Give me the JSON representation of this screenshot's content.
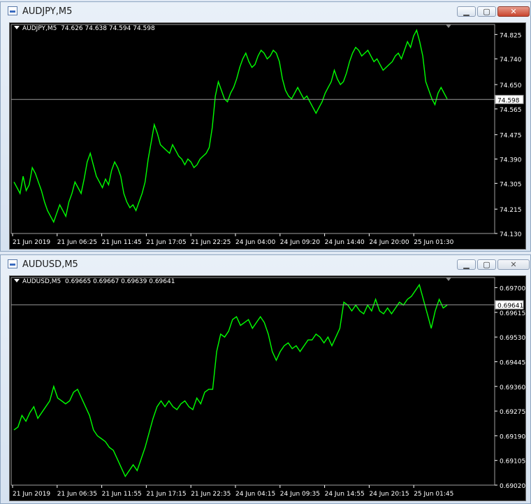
{
  "windows": [
    {
      "title": "AUDJPY,M5",
      "active": true,
      "legend_symbol": "AUDJPY,M5",
      "ohlc": "74.626 74.638 74.594 74.598",
      "current_price": "74.598",
      "current_value": 74.598,
      "price_labels": [
        "74.825",
        "74.740",
        "74.650",
        "74.565",
        "74.475",
        "74.390",
        "74.305",
        "74.215",
        "74.130"
      ],
      "price_values": [
        74.825,
        74.74,
        74.65,
        74.565,
        74.475,
        74.39,
        74.305,
        74.215,
        74.13
      ],
      "time_labels": [
        "21 Jun 2019",
        "21 Jun 06:25",
        "21 Jun 11:45",
        "21 Jun 17:05",
        "21 Jun 22:25",
        "24 Jun 04:00",
        "24 Jun 09:20",
        "24 Jun 14:40",
        "24 Jun 20:00",
        "25 Jun 01:30"
      ],
      "chart_data": {
        "type": "line",
        "ylim": [
          74.13,
          74.86
        ],
        "line_color": "#00ff00",
        "values": [
          74.31,
          74.29,
          74.27,
          74.33,
          74.28,
          74.3,
          74.36,
          74.34,
          74.31,
          74.28,
          74.24,
          74.21,
          74.19,
          74.17,
          74.2,
          74.23,
          74.21,
          74.19,
          74.24,
          74.27,
          74.31,
          74.29,
          74.27,
          74.32,
          74.38,
          74.41,
          74.37,
          74.33,
          74.31,
          74.29,
          74.32,
          74.3,
          74.35,
          74.38,
          74.36,
          74.33,
          74.27,
          74.24,
          74.22,
          74.23,
          74.21,
          74.24,
          74.27,
          74.31,
          74.39,
          74.45,
          74.51,
          74.48,
          74.44,
          74.43,
          74.42,
          74.41,
          74.44,
          74.42,
          74.4,
          74.39,
          74.37,
          74.39,
          74.38,
          74.36,
          74.37,
          74.39,
          74.4,
          74.41,
          74.43,
          74.5,
          74.61,
          74.66,
          74.63,
          74.6,
          74.59,
          74.62,
          74.64,
          74.67,
          74.71,
          74.74,
          74.76,
          74.73,
          74.71,
          74.72,
          74.75,
          74.77,
          74.76,
          74.74,
          74.75,
          74.77,
          74.76,
          74.73,
          74.67,
          74.63,
          74.61,
          74.6,
          74.62,
          74.64,
          74.62,
          74.6,
          74.61,
          74.59,
          74.57,
          74.55,
          74.57,
          74.59,
          74.62,
          74.64,
          74.66,
          74.7,
          74.67,
          74.65,
          74.66,
          74.69,
          74.73,
          74.76,
          74.78,
          74.77,
          74.75,
          74.76,
          74.77,
          74.75,
          74.73,
          74.74,
          74.72,
          74.7,
          74.71,
          74.72,
          74.73,
          74.75,
          74.76,
          74.74,
          74.77,
          74.8,
          74.78,
          74.82,
          74.84,
          74.8,
          74.75,
          74.66,
          74.63,
          74.6,
          74.58,
          74.62,
          74.64,
          74.62,
          74.6
        ]
      }
    },
    {
      "title": "AUDUSD,M5",
      "active": false,
      "legend_symbol": "AUDUSD,M5",
      "ohlc": "0.69665 0.69667 0.69639 0.69641",
      "current_price": "0.69641",
      "current_value": 0.69641,
      "price_labels": [
        "0.69700",
        "0.69615",
        "0.69530",
        "0.69445",
        "0.69360",
        "0.69275",
        "0.69190",
        "0.69105",
        "0.69020"
      ],
      "price_values": [
        0.697,
        0.69615,
        0.6953,
        0.69445,
        0.6936,
        0.69275,
        0.6919,
        0.69105,
        0.6902
      ],
      "time_labels": [
        "21 Jun 2019",
        "21 Jun 06:35",
        "21 Jun 11:55",
        "21 Jun 17:15",
        "21 Jun 22:35",
        "24 Jun 04:15",
        "24 Jun 09:35",
        "24 Jun 14:55",
        "24 Jun 20:15",
        "25 Jun 01:45"
      ],
      "chart_data": {
        "type": "line",
        "ylim": [
          0.6902,
          0.69735
        ],
        "line_color": "#00ff00",
        "values": [
          0.6921,
          0.6922,
          0.6926,
          0.6924,
          0.6927,
          0.6929,
          0.6925,
          0.6927,
          0.6929,
          0.6931,
          0.6936,
          0.6932,
          0.6931,
          0.693,
          0.6931,
          0.6934,
          0.6935,
          0.6932,
          0.6929,
          0.6926,
          0.6921,
          0.6919,
          0.6918,
          0.6917,
          0.6915,
          0.6914,
          0.6911,
          0.6908,
          0.6905,
          0.6907,
          0.6909,
          0.6907,
          0.6911,
          0.6915,
          0.692,
          0.6925,
          0.6929,
          0.6931,
          0.6929,
          0.6931,
          0.6929,
          0.6928,
          0.693,
          0.6931,
          0.6929,
          0.6928,
          0.6932,
          0.693,
          0.6934,
          0.6935,
          0.6935,
          0.6948,
          0.6954,
          0.6953,
          0.6955,
          0.6959,
          0.696,
          0.6957,
          0.6958,
          0.6959,
          0.6956,
          0.6958,
          0.696,
          0.6958,
          0.6954,
          0.6948,
          0.6945,
          0.6948,
          0.695,
          0.6951,
          0.6949,
          0.695,
          0.6948,
          0.695,
          0.6952,
          0.6952,
          0.6954,
          0.6953,
          0.6951,
          0.6953,
          0.695,
          0.6953,
          0.6956,
          0.6965,
          0.6964,
          0.6962,
          0.6964,
          0.6962,
          0.6961,
          0.6964,
          0.6962,
          0.6966,
          0.6962,
          0.6961,
          0.6963,
          0.6961,
          0.6963,
          0.6965,
          0.6964,
          0.6966,
          0.6967,
          0.6969,
          0.6971,
          0.6966,
          0.6961,
          0.6956,
          0.6962,
          0.6966,
          0.6963,
          0.6964
        ]
      }
    }
  ]
}
